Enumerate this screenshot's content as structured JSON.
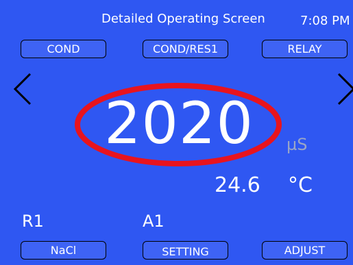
{
  "header": {
    "title": "Detailed Operating Screen",
    "time": "7:08 PM"
  },
  "top_buttons": {
    "cond": "COND",
    "cond_res": "COND/RES1",
    "relay": "RELAY"
  },
  "navigation": {
    "prev_icon": "chevron-left-icon",
    "next_icon": "chevron-right-icon"
  },
  "reading": {
    "value": "2020",
    "unit": "µS"
  },
  "temperature": {
    "value": "24.6",
    "unit": "°C"
  },
  "status": {
    "relay": "R1",
    "alarm": "A1"
  },
  "bottom_buttons": {
    "nacl": "NaCl",
    "setting": "SETTING",
    "adjust": "ADJUST"
  },
  "colors": {
    "background": "#2f57f2",
    "button_fill": "#3e63f5",
    "highlight": "#e8141e",
    "unit_gray": "#9aa6c6"
  }
}
